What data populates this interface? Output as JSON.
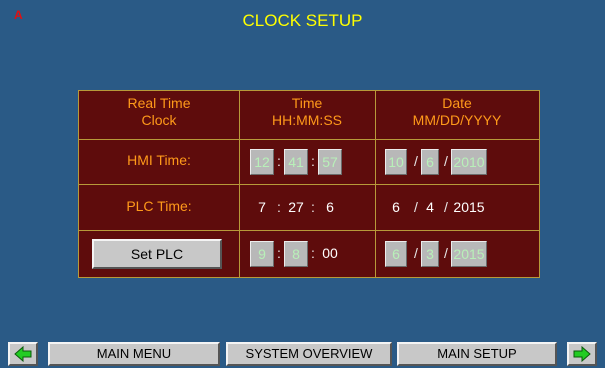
{
  "header": {
    "alarm_indicator": "A",
    "title": "CLOCK SETUP"
  },
  "table": {
    "col1_line1": "Real Time",
    "col1_line2": "Clock",
    "col2_line1": "Time",
    "col2_line2": "HH:MM:SS",
    "col3_line1": "Date",
    "col3_line2": "MM/DD/YYYY"
  },
  "hmi": {
    "label": "HMI Time:",
    "hour": "12",
    "minute": "41",
    "second": "57",
    "month": "10",
    "day": "6",
    "year": "2010"
  },
  "plc": {
    "label": "PLC Time:",
    "hour": "7",
    "minute": "27",
    "second": "6",
    "month": "6",
    "day": "4",
    "year": "2015"
  },
  "set": {
    "button_label": "Set PLC",
    "hour": "9",
    "minute": "8",
    "second": "00",
    "month": "6",
    "day": "3",
    "year": "2015"
  },
  "separators": {
    "time": ":",
    "date": "/"
  },
  "nav": {
    "main_menu": "MAIN MENU",
    "system_overview": "SYSTEM OVERVIEW",
    "main_setup": "MAIN SETUP",
    "prev_icon": "left-arrow-icon",
    "next_icon": "right-arrow-icon"
  },
  "colors": {
    "background": "#2a5a86",
    "panel": "#5e0c0c",
    "title": "#ffff00",
    "label": "#ff9a1a",
    "alarm": "#e31010",
    "arrow": "#22cc22"
  }
}
